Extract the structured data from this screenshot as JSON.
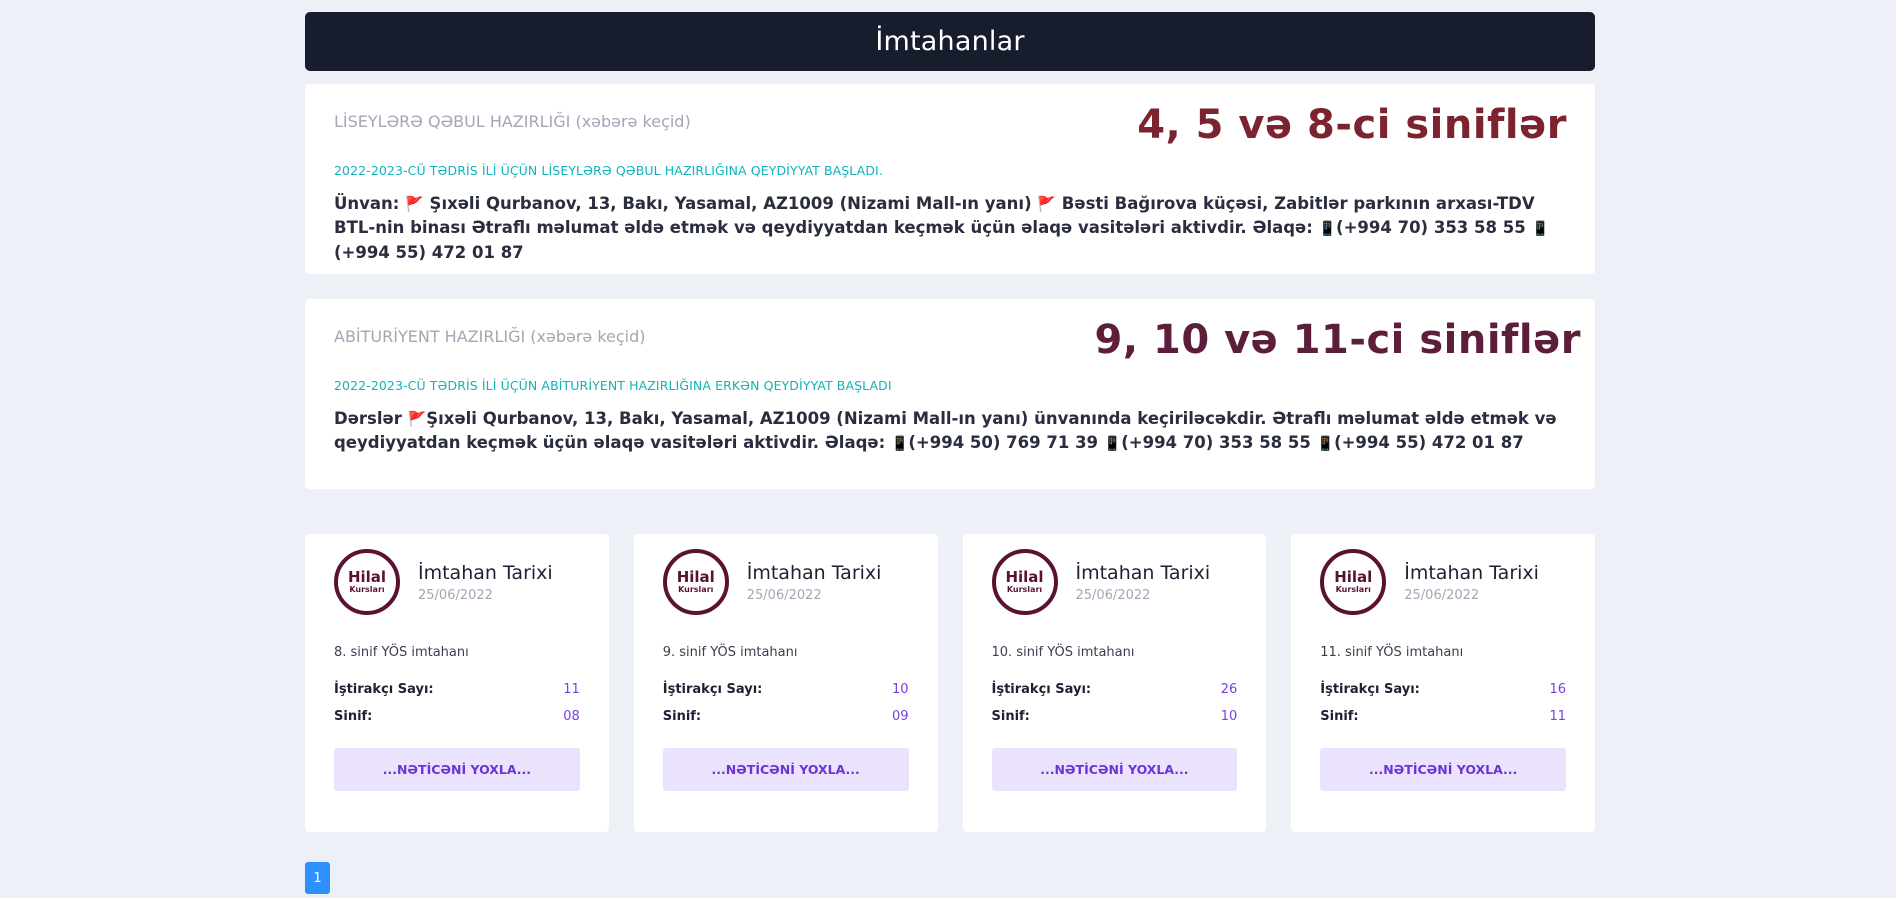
{
  "page": {
    "title": "İmtahanlar"
  },
  "news": [
    {
      "link": "LİSEYLƏRƏ QƏBUL HAZIRLIĞI (xəbərə keçid)",
      "big": "4, 5 və 8-ci siniflər",
      "subtitle": "2022-2023-CÜ TƏDRİS İLİ ÜÇÜN LİSEYLƏRƏ QƏBUL HAZIRLIĞINA QEYDİYYAT BAŞLADI.",
      "body_parts": [
        "Ünvan: ",
        "🚩",
        " Şıxəli Qurbanov, 13, Bakı, Yasamal, AZ1009 (Nizami Mall-ın yanı) ",
        "🚩",
        " Bəsti Bağırova küçəsi, Zabitlər parkının arxası-TDV BTL-nin binası Ətraflı məlumat əldə etmək və qeydiyyatdan keçmək üçün əlaqə vasitələri aktivdir. Əlaqə: ",
        "📱",
        "(+994 70) 353 58 55 ",
        "📱",
        "(+994 55) 472 01 87"
      ]
    },
    {
      "link": "ABİTURİYENT HAZIRLIĞI (xəbərə keçid)",
      "big": "9, 10 və 11-ci siniflər",
      "subtitle": "2022-2023-CÜ TƏDRİS İLİ ÜÇÜN ABİTURİYENT HAZIRLIĞINA ERKƏN QEYDİYYAT BAŞLADI",
      "body_parts": [
        "Dərslər ",
        "🚩",
        "Şıxəli Qurbanov, 13, Bakı, Yasamal, AZ1009 (Nizami Mall-ın yanı) ünvanında keçiriləcəkdir. Ətraflı məlumat əldə etmək və qeydiyyatdan keçmək üçün əlaqə vasitələri aktivdir. Əlaqə: ",
        "📱",
        "(+994 50) 769 71 39 ",
        "📱",
        "(+994 70) 353 58 55 ",
        "📱",
        "(+994 55) 472 01 87"
      ]
    }
  ],
  "logo": {
    "line1": "Hilal",
    "line2": "Kursları",
    "color": "#5a1232"
  },
  "labels": {
    "exam_title": "İmtahan Tarixi",
    "participants": "İştirakçı Sayı:",
    "grade": "Sinif:",
    "check": "...NƏTİCƏNİ YOXLA..."
  },
  "exams": [
    {
      "date": "25/06/2022",
      "name": "8. sinif YÖS imtahanı",
      "participants": "11",
      "grade": "08"
    },
    {
      "date": "25/06/2022",
      "name": "9. sinif YÖS imtahanı",
      "participants": "10",
      "grade": "09"
    },
    {
      "date": "25/06/2022",
      "name": "10. sinif YÖS imtahanı",
      "participants": "26",
      "grade": "10"
    },
    {
      "date": "25/06/2022",
      "name": "11. sinif YÖS imtahanı",
      "participants": "16",
      "grade": "11"
    }
  ],
  "pagination": {
    "current": "1"
  },
  "colors": {
    "header_bg": "#181d2e",
    "accent_teal": "#10b3b9",
    "accent_purple": "#7a3fe0",
    "page_btn": "#2e90ff"
  }
}
